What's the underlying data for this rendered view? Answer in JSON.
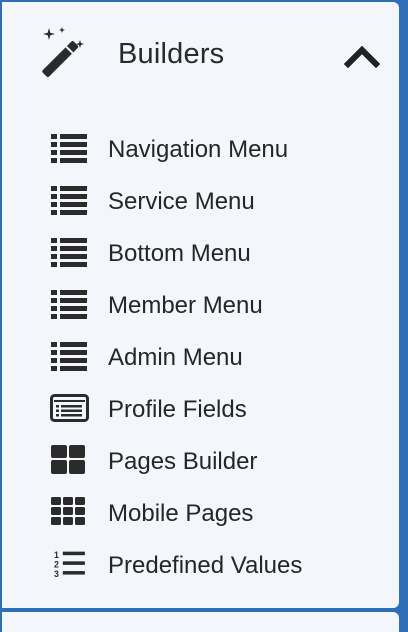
{
  "section": {
    "title": "Builders",
    "icon": "magic-wand-icon",
    "toggle_icon": "chevron-up-icon",
    "expanded": true
  },
  "items": [
    {
      "label": "Navigation Menu",
      "icon": "list-icon"
    },
    {
      "label": "Service Menu",
      "icon": "list-icon"
    },
    {
      "label": "Bottom Menu",
      "icon": "list-icon"
    },
    {
      "label": "Member Menu",
      "icon": "list-icon"
    },
    {
      "label": "Admin Menu",
      "icon": "list-icon"
    },
    {
      "label": "Profile Fields",
      "icon": "form-list-icon"
    },
    {
      "label": "Pages Builder",
      "icon": "large-grid-icon"
    },
    {
      "label": "Mobile Pages",
      "icon": "small-grid-icon"
    },
    {
      "label": "Predefined Values",
      "icon": "ordered-list-icon"
    }
  ],
  "colors": {
    "background": "#2f6fb8",
    "panel": "#f3f6fb",
    "text": "#262626",
    "icon": "#2b2b2b"
  }
}
